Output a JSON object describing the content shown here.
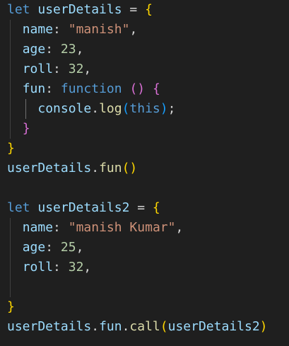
{
  "lines": [
    [
      {
        "t": "let",
        "c": "kw"
      },
      {
        "t": " ",
        "c": "plain"
      },
      {
        "t": "userDetails",
        "c": "var"
      },
      {
        "t": " = ",
        "c": "op"
      },
      {
        "t": "{",
        "c": "b1"
      }
    ],
    [
      {
        "t": "  ",
        "c": "plain"
      },
      {
        "t": "name",
        "c": "var"
      },
      {
        "t": ": ",
        "c": "op"
      },
      {
        "t": "\"manish\"",
        "c": "str"
      },
      {
        "t": ",",
        "c": "op"
      }
    ],
    [
      {
        "t": "  ",
        "c": "plain"
      },
      {
        "t": "age",
        "c": "var"
      },
      {
        "t": ": ",
        "c": "op"
      },
      {
        "t": "23",
        "c": "num"
      },
      {
        "t": ",",
        "c": "op"
      }
    ],
    [
      {
        "t": "  ",
        "c": "plain"
      },
      {
        "t": "roll",
        "c": "var"
      },
      {
        "t": ": ",
        "c": "op"
      },
      {
        "t": "32",
        "c": "num"
      },
      {
        "t": ",",
        "c": "op"
      }
    ],
    [
      {
        "t": "  ",
        "c": "plain"
      },
      {
        "t": "fun",
        "c": "var"
      },
      {
        "t": ": ",
        "c": "op"
      },
      {
        "t": "function",
        "c": "kw"
      },
      {
        "t": " ",
        "c": "plain"
      },
      {
        "t": "()",
        "c": "b2"
      },
      {
        "t": " ",
        "c": "plain"
      },
      {
        "t": "{",
        "c": "b2"
      }
    ],
    [
      {
        "t": "    ",
        "c": "plain"
      },
      {
        "t": "console",
        "c": "var"
      },
      {
        "t": ".",
        "c": "op"
      },
      {
        "t": "log",
        "c": "fn"
      },
      {
        "t": "(",
        "c": "b3"
      },
      {
        "t": "this",
        "c": "kw"
      },
      {
        "t": ")",
        "c": "b3"
      },
      {
        "t": ";",
        "c": "op"
      }
    ],
    [
      {
        "t": "  ",
        "c": "plain"
      },
      {
        "t": "}",
        "c": "b2"
      }
    ],
    [
      {
        "t": "}",
        "c": "b1"
      }
    ],
    [
      {
        "t": "userDetails",
        "c": "var"
      },
      {
        "t": ".",
        "c": "op"
      },
      {
        "t": "fun",
        "c": "fn"
      },
      {
        "t": "()",
        "c": "b1"
      }
    ],
    [],
    [
      {
        "t": "let",
        "c": "kw"
      },
      {
        "t": " ",
        "c": "plain"
      },
      {
        "t": "userDetails2",
        "c": "var"
      },
      {
        "t": " = ",
        "c": "op"
      },
      {
        "t": "{",
        "c": "b1"
      }
    ],
    [
      {
        "t": "  ",
        "c": "plain"
      },
      {
        "t": "name",
        "c": "var"
      },
      {
        "t": ": ",
        "c": "op"
      },
      {
        "t": "\"manish Kumar\"",
        "c": "str"
      },
      {
        "t": ",",
        "c": "op"
      }
    ],
    [
      {
        "t": "  ",
        "c": "plain"
      },
      {
        "t": "age",
        "c": "var"
      },
      {
        "t": ": ",
        "c": "op"
      },
      {
        "t": "25",
        "c": "num"
      },
      {
        "t": ",",
        "c": "op"
      }
    ],
    [
      {
        "t": "  ",
        "c": "plain"
      },
      {
        "t": "roll",
        "c": "var"
      },
      {
        "t": ": ",
        "c": "op"
      },
      {
        "t": "32",
        "c": "num"
      },
      {
        "t": ",",
        "c": "op"
      }
    ],
    [],
    [
      {
        "t": "}",
        "c": "b1"
      }
    ],
    [
      {
        "t": "userDetails",
        "c": "var"
      },
      {
        "t": ".",
        "c": "op"
      },
      {
        "t": "fun",
        "c": "var"
      },
      {
        "t": ".",
        "c": "op"
      },
      {
        "t": "call",
        "c": "fn"
      },
      {
        "t": "(",
        "c": "b1"
      },
      {
        "t": "userDetails2",
        "c": "var"
      },
      {
        "t": ")",
        "c": "b1"
      }
    ]
  ]
}
